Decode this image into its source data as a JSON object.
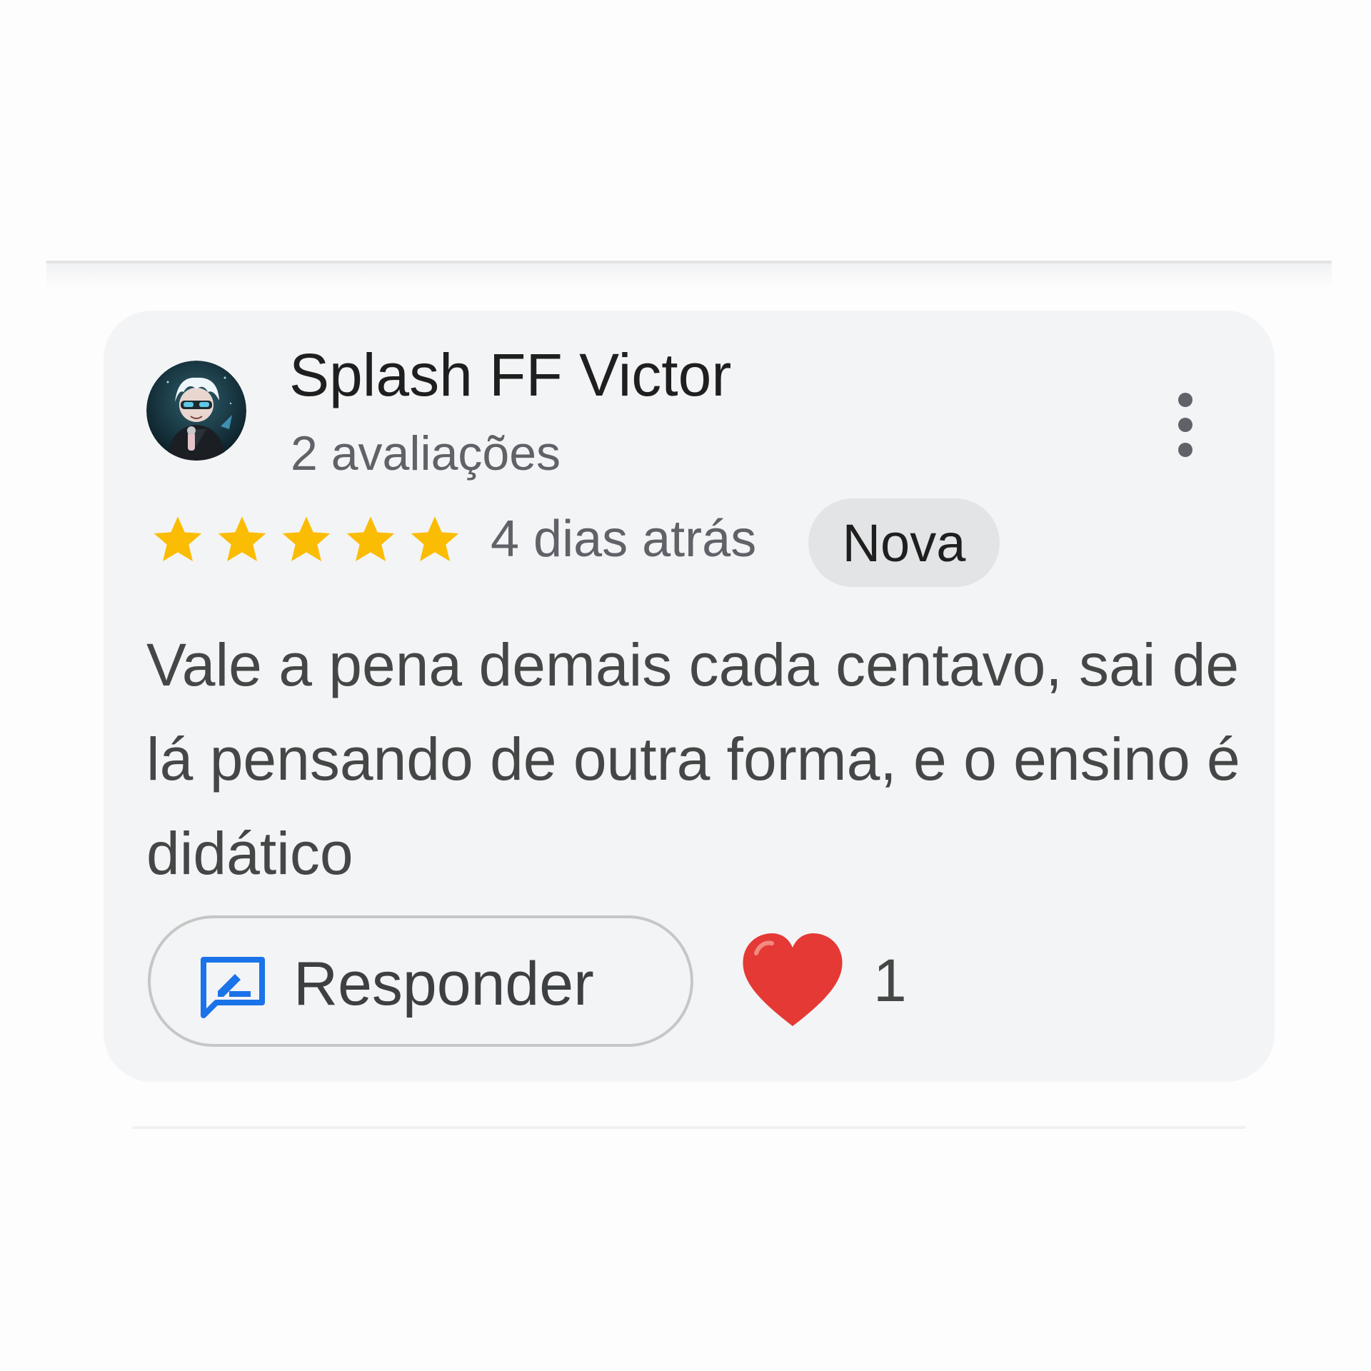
{
  "review": {
    "author_name": "Splash FF Victor",
    "author_review_count": "2 avaliações",
    "rating": 5,
    "rating_max": 5,
    "date": "4 dias atrás",
    "badge": "Nova",
    "text": "Vale a pena demais cada centavo, sai de lá pensando de outra forma, e o ensino é didático",
    "reply_label": "Responder",
    "like_count": "1"
  },
  "icons": {
    "more": "more-vert-icon",
    "star": "star-icon",
    "reply": "reply-icon",
    "heart": "heart-icon"
  },
  "colors": {
    "card_background": "#f3f4f6",
    "star": "#fbbc04",
    "reply_icon": "#1a73e8",
    "heart": "#e53935",
    "badge_background": "#e3e4e6"
  }
}
